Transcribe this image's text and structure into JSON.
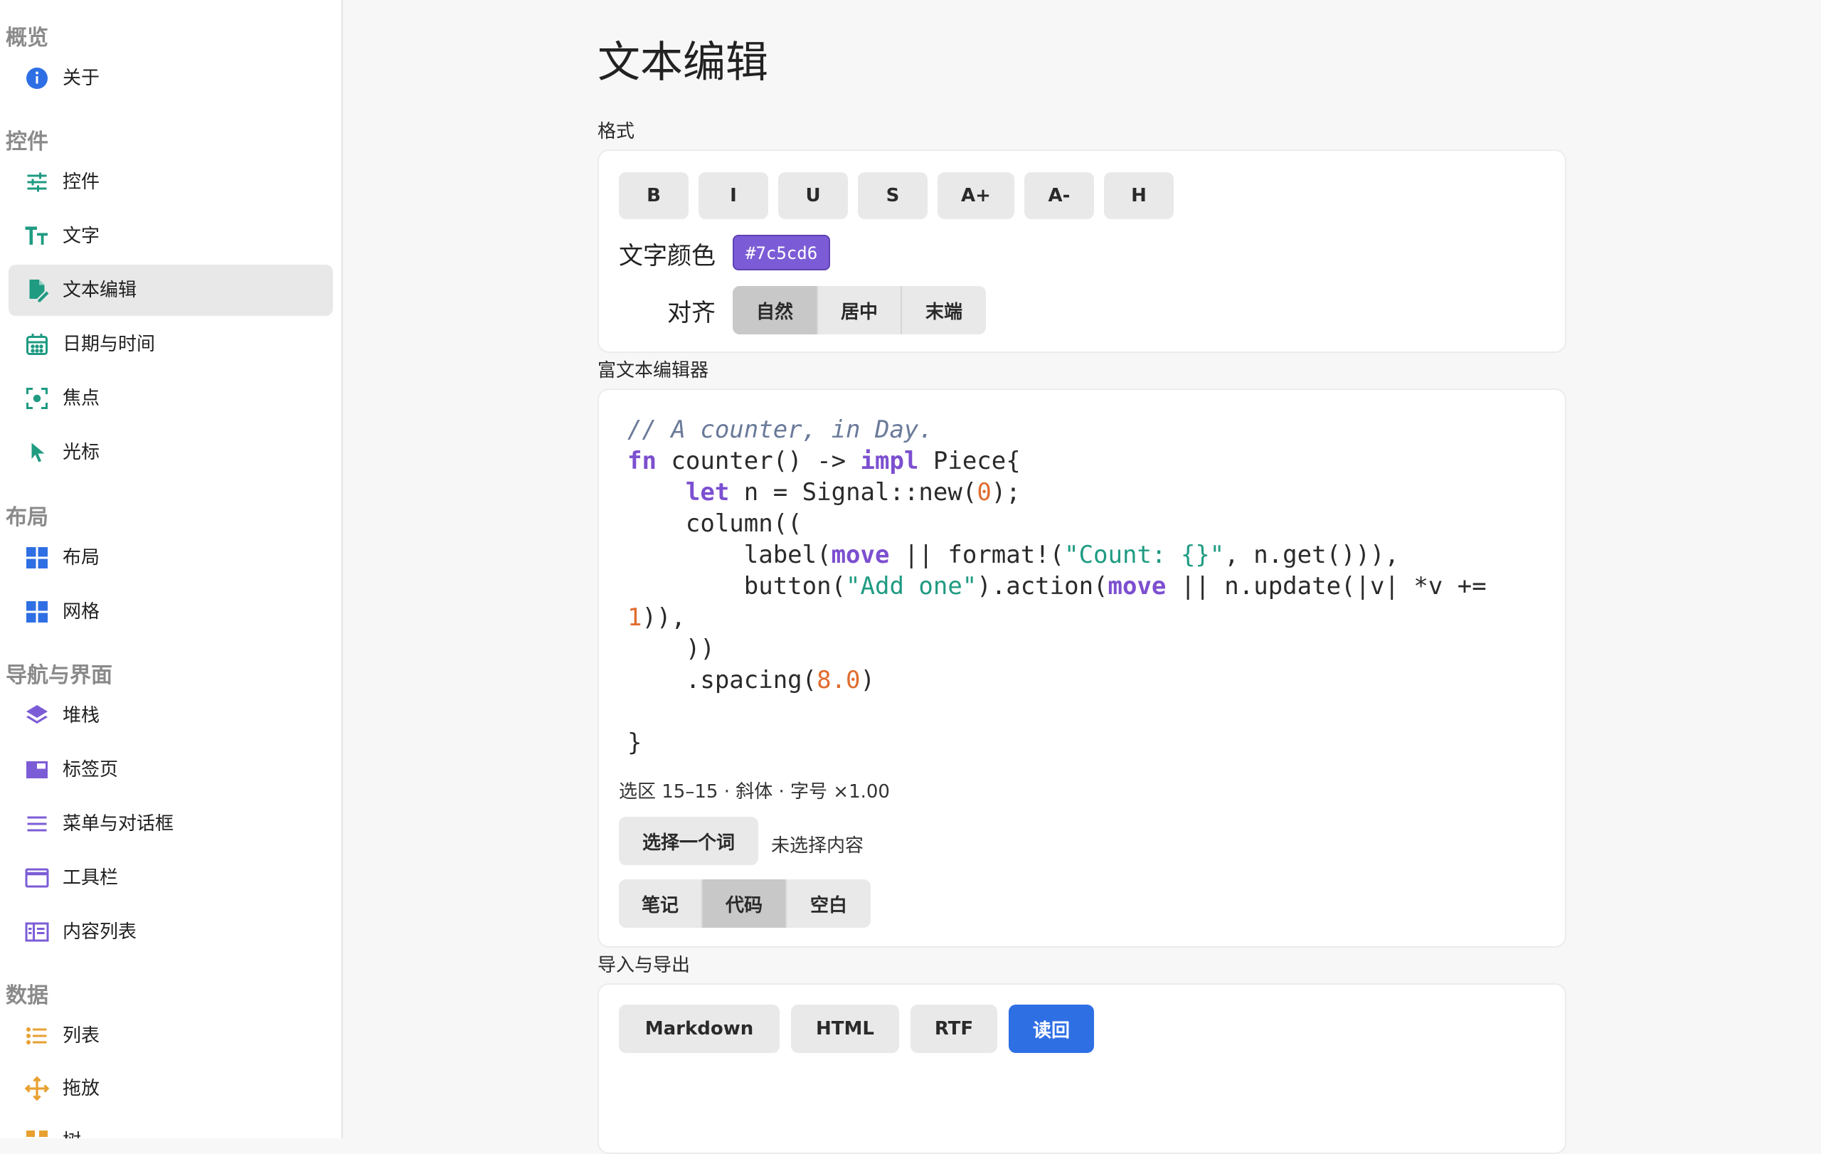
{
  "sidebar": {
    "sections": [
      {
        "title": "概览",
        "items": [
          {
            "label": "关于",
            "icon": "info-icon"
          }
        ]
      },
      {
        "title": "控件",
        "items": [
          {
            "label": "控件",
            "icon": "sliders-icon"
          },
          {
            "label": "文字",
            "icon": "text-size-icon"
          },
          {
            "label": "文本编辑",
            "icon": "edit-document-icon",
            "active": true
          },
          {
            "label": "日期与时间",
            "icon": "calendar-icon"
          },
          {
            "label": "焦点",
            "icon": "focus-icon"
          },
          {
            "label": "光标",
            "icon": "cursor-icon"
          }
        ]
      },
      {
        "title": "布局",
        "items": [
          {
            "label": "布局",
            "icon": "layout-grid-icon"
          },
          {
            "label": "网格",
            "icon": "grid-icon"
          }
        ]
      },
      {
        "title": "导航与界面",
        "items": [
          {
            "label": "堆栈",
            "icon": "layers-icon"
          },
          {
            "label": "标签页",
            "icon": "tabs-icon"
          },
          {
            "label": "菜单与对话框",
            "icon": "menu-icon"
          },
          {
            "label": "工具栏",
            "icon": "toolbar-icon"
          },
          {
            "label": "内容列表",
            "icon": "content-list-icon"
          }
        ]
      },
      {
        "title": "数据",
        "items": [
          {
            "label": "列表",
            "icon": "list-icon"
          },
          {
            "label": "拖放",
            "icon": "drag-move-icon"
          },
          {
            "label": "树",
            "icon": "tree-icon"
          }
        ]
      }
    ]
  },
  "page": {
    "title": "文本编辑"
  },
  "format": {
    "label": "格式",
    "buttons": [
      "B",
      "I",
      "U",
      "S",
      "A+",
      "A-",
      "H"
    ],
    "color_label": "文字颜色",
    "color_value": "#7c5cd6",
    "align_label": "对齐",
    "align_options": [
      "自然",
      "居中",
      "末端"
    ],
    "align_selected": "自然"
  },
  "editor": {
    "label": "富文本编辑器",
    "code": [
      "// A counter, in Day.",
      "fn counter() -> impl Piece{",
      "    let n = Signal::new(0);",
      "    column((",
      "        label(move || format!(\"Count: {}\", n.get())),",
      "        button(\"Add one\").action(move || n.update(|v| *v +=",
      "1)),",
      "    ))",
      "    .spacing(8.0)",
      "",
      "}"
    ],
    "status": "选区 15–15 · 斜体 · 字号 ×1.00",
    "select_word_button": "选择一个词",
    "selection_text": "未选择内容",
    "mode_options": [
      "笔记",
      "代码",
      "空白"
    ],
    "mode_selected": "代码"
  },
  "io": {
    "label": "导入与导出",
    "buttons": [
      "Markdown",
      "HTML",
      "RTF"
    ],
    "read_back_button": "读回"
  },
  "colors": {
    "accent": "#2f6fe4",
    "text_color_swatch": "#7c5cd6",
    "icon_teal": "#1f9b82",
    "icon_blue": "#2f6fe4",
    "icon_purple": "#7c5cd6",
    "icon_orange": "#e8a030"
  }
}
